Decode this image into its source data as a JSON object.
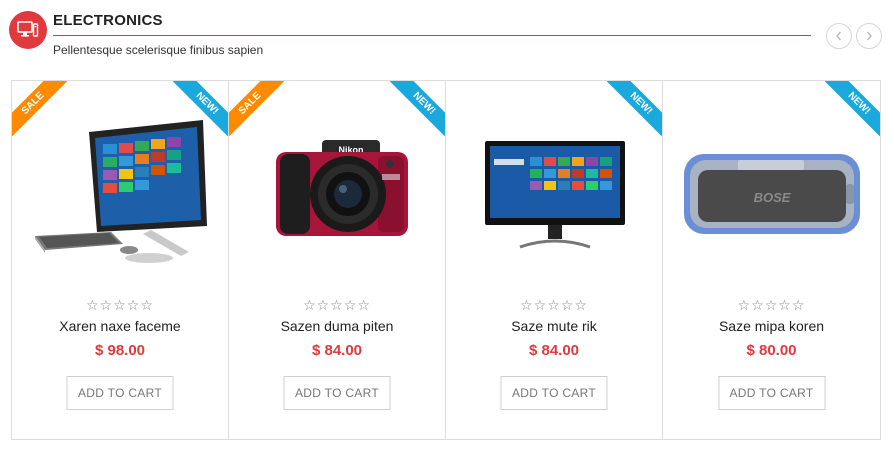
{
  "section": {
    "title": "ELECTRONICS",
    "subtitle": "Pellentesque scelerisque finibus sapien",
    "icon": "monitor-icon",
    "accent_color": "#e0393e"
  },
  "nav": {
    "prev_icon": "chevron-left-icon",
    "next_icon": "chevron-right-icon"
  },
  "colors": {
    "sale_ribbon": "#ff8a00",
    "new_ribbon": "#1ba9dd",
    "price": "#e0393e"
  },
  "products": [
    {
      "name": "Xaren naxe faceme",
      "price": "$ 98.00",
      "rating": 0,
      "max_rating": 5,
      "stars": "☆☆☆☆☆",
      "sale_label": "SALE",
      "new_label": "NEW!",
      "cart_label": "ADD TO CART",
      "image": "all-in-one-desktop-image"
    },
    {
      "name": "Sazen duma piten",
      "price": "$ 84.00",
      "rating": 0,
      "max_rating": 5,
      "stars": "☆☆☆☆☆",
      "sale_label": "SALE",
      "new_label": "NEW!",
      "cart_label": "ADD TO CART",
      "image": "red-camera-image",
      "camera_brand": "Nikon"
    },
    {
      "name": "Saze mute rik",
      "price": "$ 84.00",
      "rating": 0,
      "max_rating": 5,
      "stars": "☆☆☆☆☆",
      "sale_label": "",
      "new_label": "NEW!",
      "cart_label": "ADD TO CART",
      "image": "monitor-image"
    },
    {
      "name": "Saze mipa koren",
      "price": "$ 80.00",
      "rating": 0,
      "max_rating": 5,
      "stars": "☆☆☆☆☆",
      "sale_label": "",
      "new_label": "NEW!",
      "cart_label": "ADD TO CART",
      "image": "bluetooth-speaker-image",
      "speaker_brand": "BOSE"
    }
  ]
}
